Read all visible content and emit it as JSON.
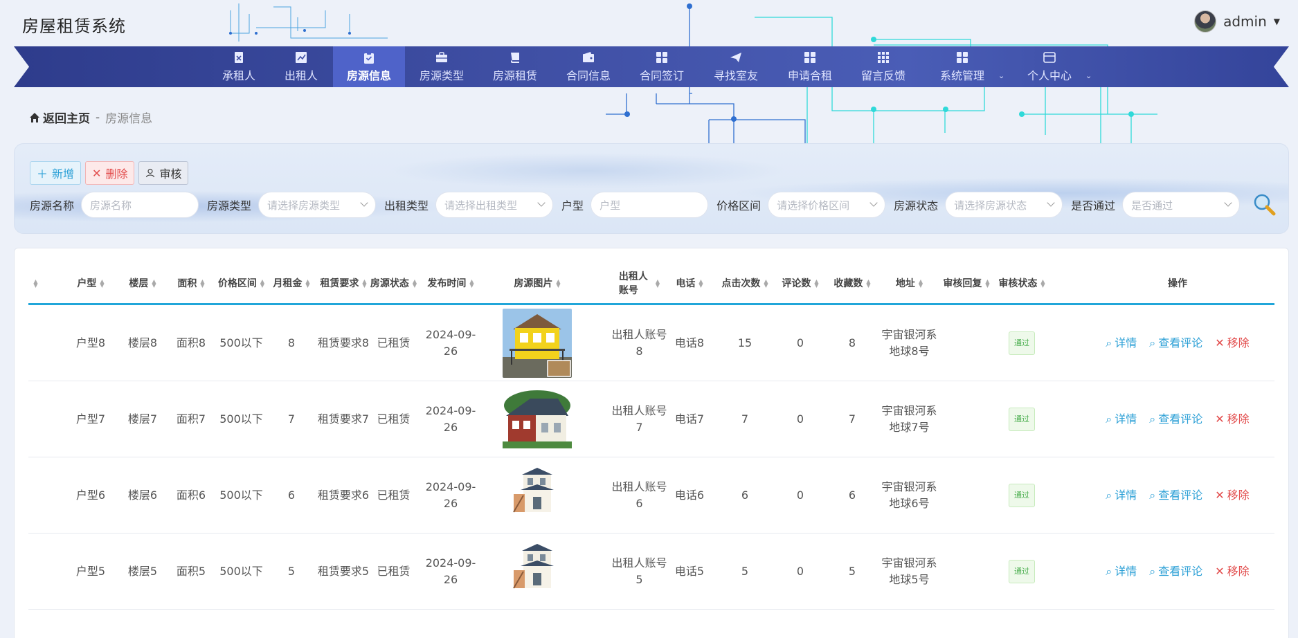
{
  "app": {
    "title": "房屋租赁系统",
    "user": "admin"
  },
  "nav": {
    "items": [
      {
        "label": "承租人",
        "icon": "id-card-icon"
      },
      {
        "label": "出租人",
        "icon": "chart-icon"
      },
      {
        "label": "房源信息",
        "icon": "clipboard-check-icon",
        "active": true
      },
      {
        "label": "房源类型",
        "icon": "briefcase-icon"
      },
      {
        "label": "房源租赁",
        "icon": "book-icon"
      },
      {
        "label": "合同信息",
        "icon": "wallet-icon"
      },
      {
        "label": "合同签订",
        "icon": "grid-icon"
      },
      {
        "label": "寻找室友",
        "icon": "send-icon"
      },
      {
        "label": "申请合租",
        "icon": "grid-icon"
      },
      {
        "label": "留言反馈",
        "icon": "grid-dots-icon"
      },
      {
        "label": "系统管理",
        "icon": "grid-icon",
        "has_dropdown": true
      },
      {
        "label": "个人中心",
        "icon": "browser-icon",
        "has_dropdown": true
      }
    ]
  },
  "breadcrumb": {
    "home": "返回主页",
    "separator": "-",
    "current": "房源信息"
  },
  "toolbar": {
    "add": "新增",
    "delete": "删除",
    "audit": "审核"
  },
  "filters": {
    "name": {
      "label": "房源名称",
      "placeholder": "房源名称"
    },
    "type": {
      "label": "房源类型",
      "placeholder": "请选择房源类型"
    },
    "rent_type": {
      "label": "出租类型",
      "placeholder": "请选择出租类型"
    },
    "layout": {
      "label": "户型",
      "placeholder": "户型"
    },
    "price": {
      "label": "价格区间",
      "placeholder": "请选择价格区间"
    },
    "status": {
      "label": "房源状态",
      "placeholder": "请选择房源状态"
    },
    "passed": {
      "label": "是否通过",
      "placeholder": "是否通过"
    }
  },
  "table": {
    "headers": {
      "layout": "户型",
      "floor": "楼层",
      "area": "面积",
      "price": "价格区间",
      "rent": "月租金",
      "req": "租赁要求",
      "status": "房源状态",
      "time": "发布时间",
      "image": "房源图片",
      "account": "出租人账号",
      "phone": "电话",
      "clicks": "点击次数",
      "comments": "评论数",
      "favs": "收藏数",
      "address": "地址",
      "reply": "审核回复",
      "audit": "审核状态",
      "ops": "操作"
    },
    "rows": [
      {
        "layout": "户型8",
        "floor": "楼层8",
        "area": "面积8",
        "price": "500以下",
        "rent": "8",
        "req": "租赁要求8",
        "status": "已租赁",
        "time": "2024-09-26",
        "account": "出租人账号8",
        "phone": "电话8",
        "clicks": "15",
        "comments": "0",
        "favs": "8",
        "address": "宇宙银河系地球8号",
        "audit": "通过"
      },
      {
        "layout": "户型7",
        "floor": "楼层7",
        "area": "面积7",
        "price": "500以下",
        "rent": "7",
        "req": "租赁要求7",
        "status": "已租赁",
        "time": "2024-09-26",
        "account": "出租人账号7",
        "phone": "电话7",
        "clicks": "7",
        "comments": "0",
        "favs": "7",
        "address": "宇宙银河系地球7号",
        "audit": "通过"
      },
      {
        "layout": "户型6",
        "floor": "楼层6",
        "area": "面积6",
        "price": "500以下",
        "rent": "6",
        "req": "租赁要求6",
        "status": "已租赁",
        "time": "2024-09-26",
        "account": "出租人账号6",
        "phone": "电话6",
        "clicks": "6",
        "comments": "0",
        "favs": "6",
        "address": "宇宙银河系地球6号",
        "audit": "通过"
      },
      {
        "layout": "户型5",
        "floor": "楼层5",
        "area": "面积5",
        "price": "500以下",
        "rent": "5",
        "req": "租赁要求5",
        "status": "已租赁",
        "time": "2024-09-26",
        "account": "出租人账号5",
        "phone": "电话5",
        "clicks": "5",
        "comments": "0",
        "favs": "5",
        "address": "宇宙银河系地球5号",
        "audit": "通过"
      }
    ],
    "ops": {
      "detail": "详情",
      "comments": "查看评论",
      "remove": "移除"
    }
  }
}
